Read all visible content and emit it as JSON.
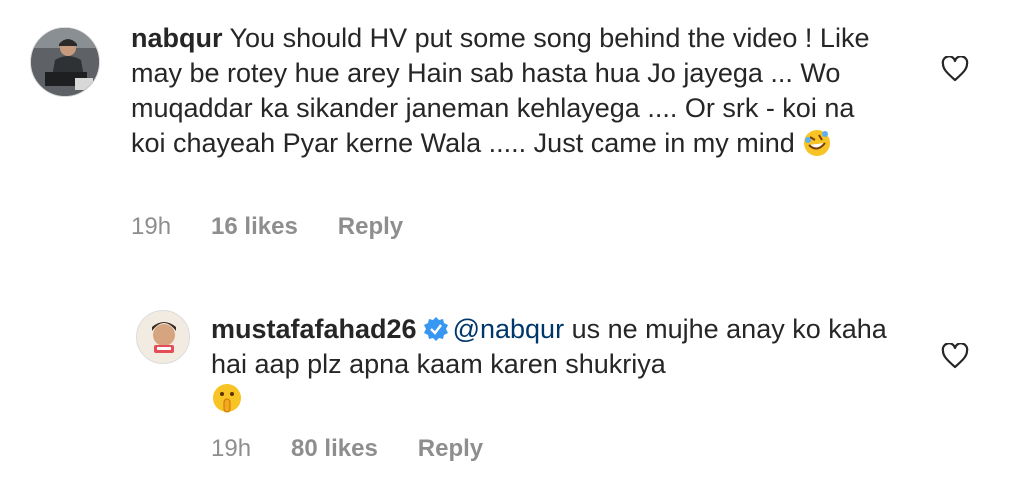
{
  "comments": [
    {
      "username": "nabqur",
      "text": "You should HV put some song behind the video ! Like may be rotey hue arey Hain sab hasta hua Jo jayega ... Wo muqaddar ka sikander janeman kehlayega .... Or srk - koi na koi chayeah Pyar kerne Wala ..... Just came in my mind",
      "emoji": "rolling-on-floor-laughing-emoji",
      "time": "19h",
      "likes": "16 likes",
      "reply_label": "Reply"
    },
    {
      "username": "mustafafahad26",
      "verified": true,
      "mention": "@nabqur",
      "text": "us ne mujhe anay ko kaha hai aap plz apna kaam karen shukriya",
      "emoji": "shushing-face-emoji",
      "time": "19h",
      "likes": "80 likes",
      "reply_label": "Reply"
    }
  ],
  "colors": {
    "text": "#262626",
    "meta": "#8e8e8e",
    "mention": "#00376b",
    "verified": "#3897f0"
  }
}
